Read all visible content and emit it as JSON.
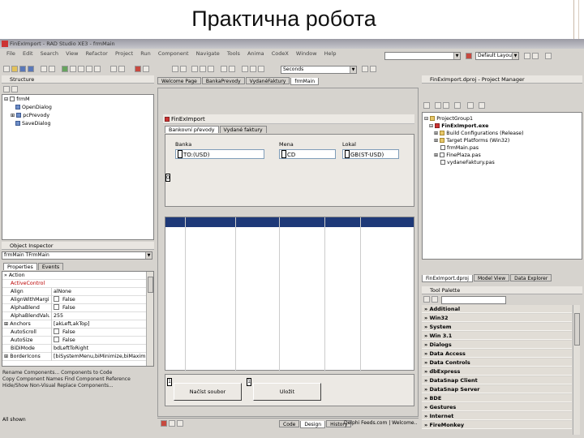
{
  "slide": {
    "title": "Практична робота"
  },
  "ide": {
    "title": "FinExImport - RAD Studio XE3 - frmMain",
    "menu": [
      "File",
      "Edit",
      "Search",
      "View",
      "Refactor",
      "Project",
      "Run",
      "Component",
      "Navigate",
      "Tools",
      "Anima",
      "CodeX",
      "Window",
      "Help"
    ],
    "search_combo": "Seconds",
    "layout_combo": "Default Layout",
    "structure": {
      "title": "Structure",
      "nodes": [
        "frmM",
        "OpenDialog",
        "pcPrevody",
        "SaveDialog"
      ]
    },
    "object_inspector": {
      "title": "Object Inspector",
      "selector": "frmMain   TFrmMain",
      "tabs": [
        "Properties",
        "Events"
      ],
      "rows": [
        {
          "k": "Action",
          "v": ""
        },
        {
          "k": "ActiveControl",
          "v": ""
        },
        {
          "k": "Align",
          "v": "alNone"
        },
        {
          "k": "AlignWithMargins",
          "v": "False"
        },
        {
          "k": "AlphaBlend",
          "v": "False"
        },
        {
          "k": "AlphaBlendValue",
          "v": "255"
        },
        {
          "k": "Anchors",
          "v": "[akLeft,akTop]"
        },
        {
          "k": "AutoScroll",
          "v": "False"
        },
        {
          "k": "AutoSize",
          "v": "False"
        },
        {
          "k": "BiDiMode",
          "v": "bdLeftToRight"
        },
        {
          "k": "BorderIcons",
          "v": "[biSystemMenu,biMinimize,biMaximize]"
        }
      ],
      "actions": [
        "Rename Components... Components to Code",
        "Copy Component Names  Find Component Reference",
        "Hide/Show Non-Visual  Replace Components..."
      ],
      "footer": "All shown"
    },
    "editor_tabs": [
      "Welcome Page",
      "BankaPrevody",
      "VydanéFaktury",
      "frmMain"
    ],
    "form": {
      "caption": "FinExImport",
      "tabs": [
        "Bankovní převody",
        "Vydané faktury"
      ],
      "labels": {
        "banka": "Banka",
        "mena": "Mena",
        "lokal": "Lokal"
      },
      "fields": {
        "banka": "TO:(USD)",
        "mena": "CD",
        "lokal": "GB(ST-USD)"
      },
      "grid_marker": "0",
      "btn_marker1": "1",
      "btn_marker2": "1",
      "btn_nacist": "Načíst soubor",
      "btn_ulozit": "Uložit"
    },
    "editor_bottom_tabs": [
      "Code",
      "Design",
      "History"
    ],
    "editor_status": "Delphi Feeds.com | Welcome...",
    "project_manager": {
      "title": "FinExImport.dproj - Project Manager",
      "nodes": [
        "ProjectGroup1",
        "FinExImport.exe",
        "Build Configurations (Release)",
        "Target Platforms (Win32)",
        "frmMain.pas",
        "FinePlaza.pas",
        "vydaneFaktury.pas"
      ],
      "bottom_tabs": [
        "FinExImport.dproj",
        "Model View",
        "Data Explorer"
      ]
    },
    "tool_palette": {
      "title": "Tool Palette",
      "categories": [
        "Additional",
        "Win32",
        "System",
        "Win 3.1",
        "Dialogs",
        "Data Access",
        "Data Controls",
        "dbExpress",
        "DataSnap Client",
        "DataSnap Server",
        "BDE",
        "Gestures",
        "Internet",
        "FireMonkey"
      ]
    }
  }
}
